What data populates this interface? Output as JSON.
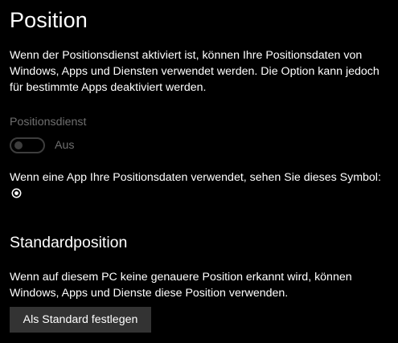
{
  "page": {
    "title": "Position",
    "intro": "Wenn der Positionsdienst aktiviert ist, können Ihre Positionsdaten von Windows, Apps und Diensten verwendet werden. Die Option kann jedoch für bestimmte Apps deaktiviert werden."
  },
  "location_service": {
    "label": "Positionsdienst",
    "toggle_state": "Aus",
    "enabled": false
  },
  "symbol_note": {
    "text": "Wenn eine App Ihre Positionsdaten verwendet, sehen Sie dieses Symbol:",
    "icon": "location-in-use-icon"
  },
  "default_location": {
    "title": "Standardposition",
    "description": "Wenn auf diesem PC keine genauere Position erkannt wird, können Windows, Apps und Dienste diese Position verwenden.",
    "button_label": "Als Standard festlegen"
  },
  "colors": {
    "background": "#000000",
    "text": "#ffffff",
    "disabled_text": "#6f6f6f",
    "disabled_control": "#3d3d3d",
    "button_background": "#333333"
  }
}
